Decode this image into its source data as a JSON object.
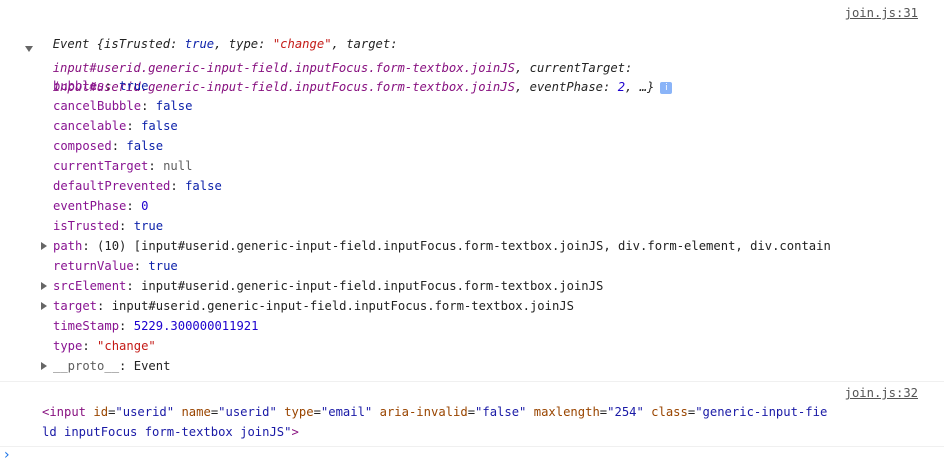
{
  "log1": {
    "source": "join.js:31",
    "summary_l1_a": "Event {isTrusted: ",
    "summary_l1_true": "true",
    "summary_l1_b": ", type: ",
    "summary_l1_type": "\"change\"",
    "summary_l1_c": ", target:",
    "summary_l2_target": "input#userid.generic-input-field.inputFocus.form-textbox.joinJS",
    "summary_l2_b": ", currentTarget:",
    "summary_l3_curtarget": "input#userid.generic-input-field.inputFocus.form-textbox.joinJS",
    "summary_l3_b": ", eventPhase: ",
    "summary_l3_phase": "2",
    "summary_l3_c": ", …}",
    "info_badge": "i",
    "props": [
      {
        "key": "bubbles",
        "val": "true",
        "kind": "bool"
      },
      {
        "key": "cancelBubble",
        "val": "false",
        "kind": "bool"
      },
      {
        "key": "cancelable",
        "val": "false",
        "kind": "bool"
      },
      {
        "key": "composed",
        "val": "false",
        "kind": "bool"
      },
      {
        "key": "currentTarget",
        "val": "null",
        "kind": "null"
      },
      {
        "key": "defaultPrevented",
        "val": "false",
        "kind": "bool"
      },
      {
        "key": "eventPhase",
        "val": "0",
        "kind": "num"
      },
      {
        "key": "isTrusted",
        "val": "true",
        "kind": "bool"
      },
      {
        "key": "path",
        "val": "(10) [input#userid.generic-input-field.inputFocus.form-textbox.joinJS, div.form-element, div.contain",
        "kind": "path",
        "expandable": true
      },
      {
        "key": "returnValue",
        "val": "true",
        "kind": "bool"
      },
      {
        "key": "srcElement",
        "val": "input#userid.generic-input-field.inputFocus.form-textbox.joinJS",
        "kind": "obj",
        "expandable": true
      },
      {
        "key": "target",
        "val": "input#userid.generic-input-field.inputFocus.form-textbox.joinJS",
        "kind": "obj",
        "expandable": true
      },
      {
        "key": "timeStamp",
        "val": "5229.300000011921",
        "kind": "num"
      },
      {
        "key": "type",
        "val": "\"change\"",
        "kind": "str"
      },
      {
        "key": "__proto__",
        "val": "Event",
        "kind": "obj",
        "expandable": true,
        "dim": true
      }
    ]
  },
  "log2": {
    "source": "join.js:32",
    "open": "<input ",
    "attrs1": [
      {
        "name": "id",
        "value": "\"userid\""
      },
      {
        "name": "name",
        "value": "\"userid\""
      },
      {
        "name": "type",
        "value": "\"email\""
      },
      {
        "name": "aria-invalid",
        "value": "\"false\""
      },
      {
        "name": "maxlength",
        "value": "\"254\""
      }
    ],
    "class_name": "class",
    "class_val_l1": "\"generic-input-fie",
    "class_val_l2": "ld inputFocus form-textbox joinJS\"",
    "close": ">"
  },
  "prompt": {
    "symbol": "›"
  }
}
